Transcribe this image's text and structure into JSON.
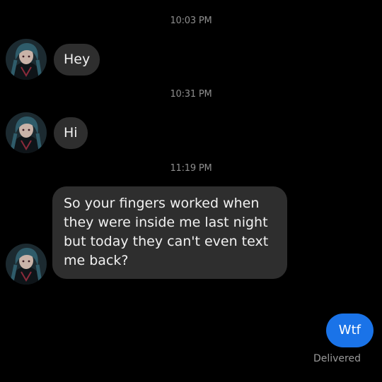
{
  "conversation": {
    "messages": [
      {
        "timestamp": "10:03 PM",
        "text": "Hey"
      },
      {
        "timestamp": "10:31 PM",
        "text": "Hi"
      },
      {
        "timestamp": "11:19 PM",
        "text": "So your fingers worked when they were inside me last night but today they can't even text me back?"
      }
    ],
    "outgoing": {
      "text": "Wtf",
      "status": "Delivered"
    }
  },
  "theme": {
    "background": "#000000",
    "incoming_bubble": "#2e2e2e",
    "outgoing_bubble": "#1a73e8",
    "timestamp_color": "#8e8e8e"
  },
  "icons": {
    "avatar": "contact-avatar-icon"
  }
}
